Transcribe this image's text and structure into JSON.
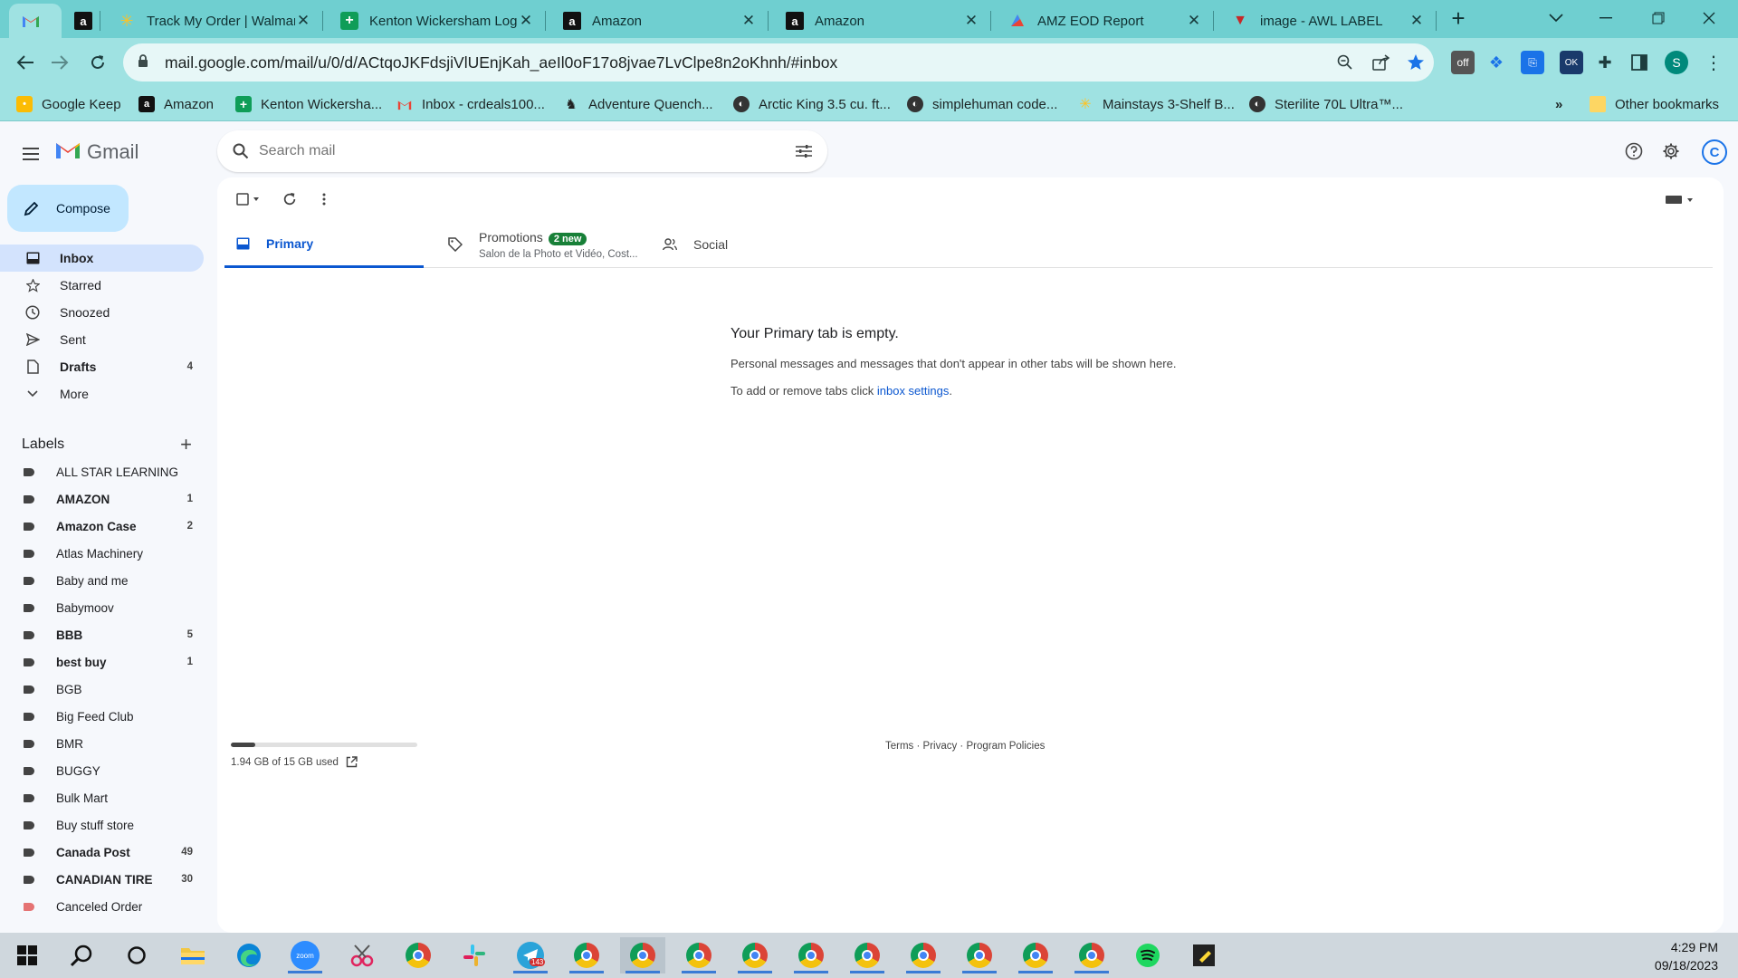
{
  "browser": {
    "tabs": [
      {
        "title": "",
        "icon": "gmail-icon",
        "active": true
      },
      {
        "title": "",
        "icon": "amazon-icon"
      },
      {
        "title": "Track My Order | Walmart",
        "icon": "walmart-icon"
      },
      {
        "title": "Kenton Wickersham Log",
        "icon": "sheets-icon"
      },
      {
        "title": "Amazon",
        "icon": "amazon-icon"
      },
      {
        "title": "Amazon",
        "icon": "amazon-icon"
      },
      {
        "title": "AMZ EOD Report",
        "icon": "report-icon"
      },
      {
        "title": "image - AWL LABEL",
        "icon": "label-icon"
      }
    ],
    "url": "mail.google.com/mail/u/0/d/ACtqoJKFdsjiVlUEnjKah_aeIl0oF17o8jvae7LvClpe8n2oKhnh/#inbox",
    "profile_initial": "S",
    "bookmarks": [
      "Google Keep",
      "Amazon",
      "Kenton Wickersha...",
      "Inbox - crdeals100...",
      "Adventure Quench...",
      "Arctic King 3.5 cu. ft...",
      "simplehuman code...",
      "Mainstays 3-Shelf B...",
      "Sterilite 70L Ultra™..."
    ],
    "other_bookmarks": "Other bookmarks",
    "more_bookmarks": "»"
  },
  "gmail": {
    "logo_text": "Gmail",
    "search_placeholder": "Search mail",
    "compose_label": "Compose",
    "nav": [
      {
        "label": "Inbox",
        "count": "",
        "icon": "inbox-icon"
      },
      {
        "label": "Starred",
        "count": "",
        "icon": "star-icon"
      },
      {
        "label": "Snoozed",
        "count": "",
        "icon": "clock-icon"
      },
      {
        "label": "Sent",
        "count": "",
        "icon": "send-icon"
      },
      {
        "label": "Drafts",
        "count": "4",
        "icon": "draft-icon"
      },
      {
        "label": "More",
        "count": "",
        "icon": "chevron-down-icon"
      }
    ],
    "labels_title": "Labels",
    "labels": [
      {
        "label": "ALL STAR LEARNING",
        "count": "",
        "bold": false
      },
      {
        "label": "AMAZON",
        "count": "1",
        "bold": true
      },
      {
        "label": "Amazon Case",
        "count": "2",
        "bold": true
      },
      {
        "label": "Atlas Machinery",
        "count": "",
        "bold": false
      },
      {
        "label": "Baby and me",
        "count": "",
        "bold": false
      },
      {
        "label": "Babymoov",
        "count": "",
        "bold": false
      },
      {
        "label": "BBB",
        "count": "5",
        "bold": true
      },
      {
        "label": "best buy",
        "count": "1",
        "bold": true
      },
      {
        "label": "BGB",
        "count": "",
        "bold": false
      },
      {
        "label": "Big Feed Club",
        "count": "",
        "bold": false
      },
      {
        "label": "BMR",
        "count": "",
        "bold": false
      },
      {
        "label": "BUGGY",
        "count": "",
        "bold": false
      },
      {
        "label": "Bulk Mart",
        "count": "",
        "bold": false
      },
      {
        "label": "Buy stuff store",
        "count": "",
        "bold": false
      },
      {
        "label": "Canada Post",
        "count": "49",
        "bold": true
      },
      {
        "label": "CANADIAN TIRE",
        "count": "30",
        "bold": true
      },
      {
        "label": "Canceled Order",
        "count": "",
        "bold": false,
        "color": "#e57373"
      }
    ],
    "tabs": {
      "primary": "Primary",
      "promotions": "Promotions",
      "promotions_badge": "2 new",
      "promotions_sub": "Salon de la Photo et Vidéo, Cost...",
      "social": "Social"
    },
    "empty": {
      "heading": "Your Primary tab is empty.",
      "line1": "Personal messages and messages that don't appear in other tabs will be shown here.",
      "line2_prefix": "To add or remove tabs click ",
      "line2_link": "inbox settings",
      "line2_suffix": "."
    },
    "storage": {
      "text": "1.94 GB of 15 GB used",
      "used_fraction": 0.13
    },
    "footer": "Terms · Privacy · Program Policies"
  },
  "taskbar": {
    "time": "4:29 PM",
    "date": "09/18/2023",
    "telegram_badge": "143"
  }
}
